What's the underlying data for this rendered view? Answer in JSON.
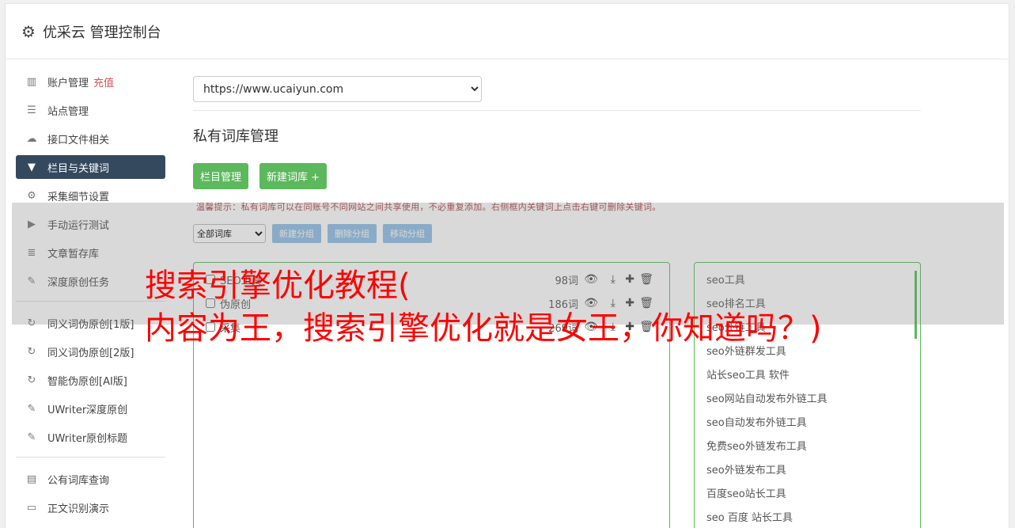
{
  "header": {
    "title": "优采云 管理控制台"
  },
  "sidebar": {
    "items": [
      {
        "label": "账户管理",
        "tag": "充值",
        "icon": "bar-chart-icon"
      },
      {
        "label": "站点管理",
        "icon": "server-icon"
      },
      {
        "label": "接口文件相关",
        "icon": "cloud-upload-icon"
      },
      {
        "label": "栏目与关键词",
        "icon": "filter-icon",
        "active": true
      },
      {
        "label": "采集细节设置",
        "icon": "cogs-icon"
      },
      {
        "label": "手动运行测试",
        "icon": "play-icon"
      },
      {
        "label": "文章暂存库",
        "icon": "database-icon"
      },
      {
        "label": "深度原创任务",
        "icon": "edit-icon"
      },
      {
        "label": "同义词伪原创[1版]",
        "icon": "refresh-icon"
      },
      {
        "label": "同义词伪原创[2版]",
        "icon": "refresh-icon"
      },
      {
        "label": "智能伪原创[AI版]",
        "icon": "refresh-icon"
      },
      {
        "label": "UWriter深度原创",
        "icon": "edit-icon"
      },
      {
        "label": "UWriter原创标题",
        "icon": "edit-icon"
      },
      {
        "label": "公有词库查询",
        "icon": "book-icon"
      },
      {
        "label": "正文识别演示",
        "icon": "monitor-icon"
      }
    ]
  },
  "main": {
    "site_select": "https://www.ucaiyun.com",
    "section_title": "私有词库管理",
    "btn_columns": "栏目管理",
    "btn_new_lib": "新建词库 +",
    "tip": "温馨提示：私有词库可以在同账号不同网站之间共享使用，不必重复添加。右侧框内关键词上点击右键可删除关键词。",
    "group_select": "全部词库",
    "btn_new_group": "新建分组",
    "btn_delete_group": "删除分组",
    "btn_move_group": "移动分组",
    "libraries": [
      {
        "name": "SEO工具",
        "count": "98词"
      },
      {
        "name": "伪原创",
        "count": "186词"
      },
      {
        "name": "采集",
        "count": "269词"
      }
    ],
    "keywords": [
      "seo工具",
      "seo排名工具",
      "seo外链工具",
      "seo外链群发工具",
      "站长seo工具 软件",
      "seo网站自动发布外链工具",
      "seo自动发布外链工具",
      "免费seo外链发布工具",
      "seo外链发布工具",
      "百度seo站长工具",
      "seo 百度 站长工具"
    ]
  },
  "overlay": {
    "line1": "搜索引擎优化教程(",
    "line2": "内容为王，搜索引擎优化就是女王，你知道吗？)"
  },
  "colors": {
    "accent_green": "#5cb85c",
    "nav_active": "#34495e",
    "headline": "#ff0000",
    "tip": "#a94442"
  }
}
